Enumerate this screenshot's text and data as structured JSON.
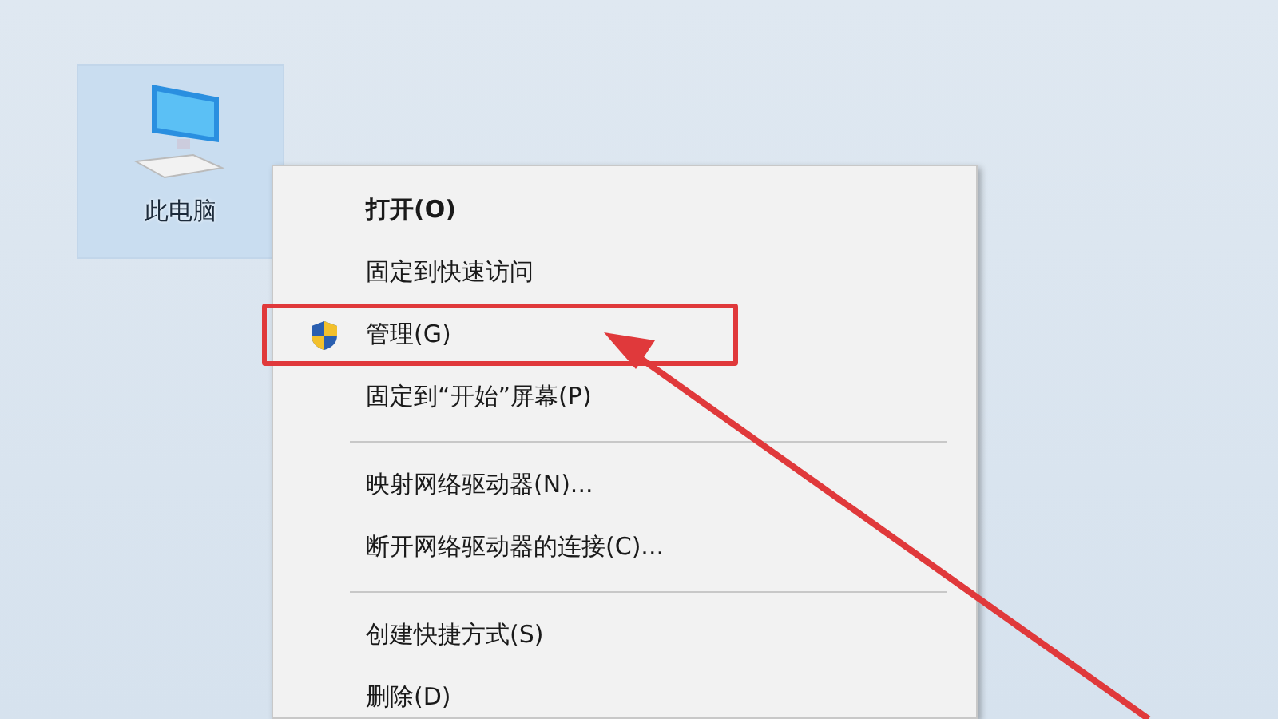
{
  "desktop_icon": {
    "label": "此电脑",
    "selected": true
  },
  "context_menu": {
    "items": [
      {
        "kind": "item",
        "label": "打开(O)",
        "default": true,
        "highlighted": false
      },
      {
        "kind": "item",
        "label": "固定到快速访问",
        "default": false,
        "highlighted": false
      },
      {
        "kind": "admin_item",
        "label": "管理(G)",
        "default": false,
        "highlighted": true
      },
      {
        "kind": "item",
        "label": "固定到“开始”屏幕(P)",
        "default": false,
        "highlighted": false
      },
      {
        "kind": "separator"
      },
      {
        "kind": "item",
        "label": "映射网络驱动器(N)...",
        "default": false,
        "highlighted": false
      },
      {
        "kind": "item",
        "label": "断开网络驱动器的连接(C)...",
        "default": false,
        "highlighted": false
      },
      {
        "kind": "separator"
      },
      {
        "kind": "item",
        "label": "创建快捷方式(S)",
        "default": false,
        "highlighted": false
      },
      {
        "kind": "item",
        "label": "删除(D)",
        "default": false,
        "highlighted": false
      }
    ]
  }
}
